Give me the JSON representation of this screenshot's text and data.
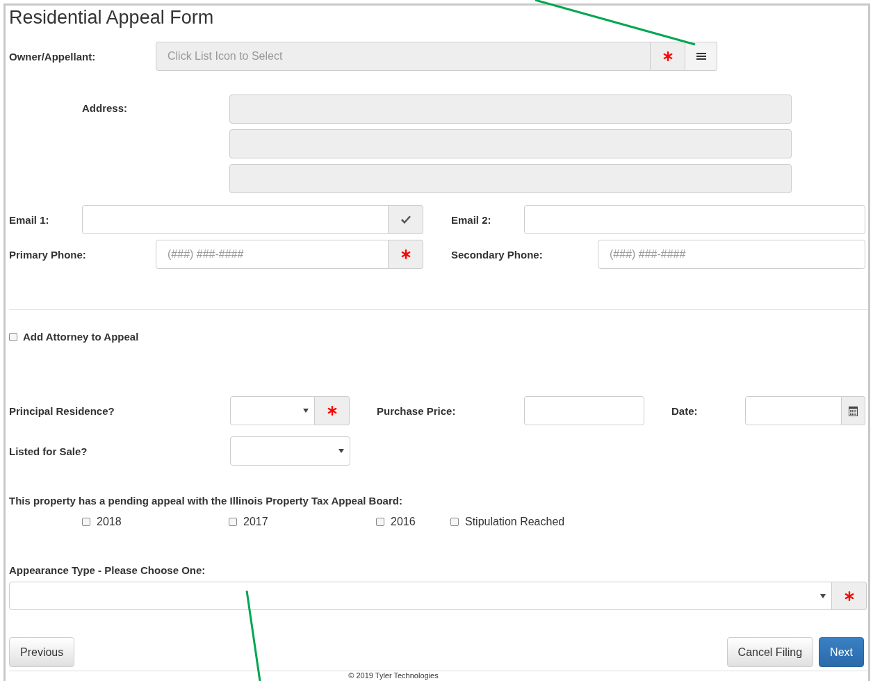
{
  "title": "Residential Appeal Form",
  "owner": {
    "label": "Owner/Appellant:",
    "placeholder": "Click List Icon to Select",
    "disabled": true,
    "required": true,
    "list_button": true
  },
  "address": {
    "label": "Address:",
    "lines": [
      {
        "disabled": true
      },
      {
        "disabled": true
      },
      {
        "disabled": true
      }
    ]
  },
  "contact_rows": [
    {
      "fields": [
        {
          "label": "Email 1:",
          "kind": "email1",
          "validated": true
        },
        {
          "label": "Email 2:",
          "kind": "email2"
        }
      ]
    },
    {
      "fields": [
        {
          "label": "Primary Phone:",
          "kind": "phone1",
          "placeholder": "(###) ###-####",
          "required": true
        },
        {
          "label": "Secondary Phone:",
          "kind": "phone2",
          "placeholder": "(###) ###-####"
        }
      ]
    }
  ],
  "attorney": {
    "label": "Add Attorney to Appeal",
    "checked": false
  },
  "principal_residence": {
    "label": "Principal Residence?",
    "required": true
  },
  "purchase_price": {
    "label": "Purchase Price:"
  },
  "date": {
    "label": "Date:",
    "calendar_button": true
  },
  "listed_for_sale": {
    "label": "Listed for Sale?"
  },
  "pending_appeal": {
    "label": "This property has a pending appeal with the Illinois Property Tax Appeal Board:",
    "options": [
      {
        "label": "2018",
        "checked": false
      },
      {
        "label": "2017",
        "checked": false
      },
      {
        "label": "2016",
        "checked": false
      },
      {
        "label": "Stipulation Reached",
        "checked": false
      }
    ]
  },
  "appearance_type": {
    "label": "Appearance Type - Please Choose One:",
    "required": true
  },
  "buttons": [
    {
      "label": "Previous",
      "kind": "default"
    },
    {
      "label": "Cancel Filing",
      "kind": "default"
    },
    {
      "label": "Next",
      "kind": "primary"
    }
  ],
  "footer": "© 2019 Tyler Technologies",
  "annotations": [
    {
      "kind": "line",
      "color": "#00a651"
    },
    {
      "kind": "line",
      "color": "#00a651"
    }
  ]
}
